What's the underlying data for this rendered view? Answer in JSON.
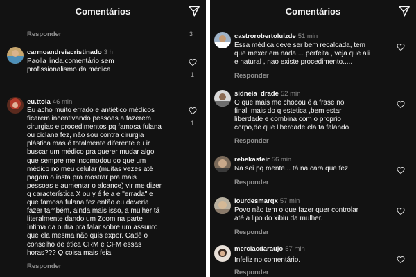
{
  "app": {
    "title": "Comentários",
    "share_icon": "send-icon",
    "heart_icon": "heart-outline-icon",
    "reply_label": "Responder"
  },
  "left": {
    "top_reply_count": "3",
    "comments": [
      {
        "username": "carmoandreiacristinado",
        "time": "3 h",
        "text": [
          "Paolla linda,comentário sem",
          "profissionalismo da médica"
        ],
        "likes": "1"
      },
      {
        "username": "eu.ttoia",
        "time": "46 min",
        "text": [
          "Eu acho muito errado e antiético médicos",
          "ficarem incentivando pessoas a fazerem",
          "cirurgias e procedimentos pq famosa fulana",
          "ou ciclana fez, não sou contra cirurgia",
          "plástica mas é totalmente diferente eu ir",
          "buscar um médico pra querer mudar algo",
          "que sempre me incomodou do que um",
          "médico no meu celular (muitas vezes até",
          "pagam o insta pra mostrar pra mais",
          "pessoas e aumentar o alcance) vir me dizer",
          "q característica X ou y é feia e \"errada\" e",
          "que famosa fulana fez então eu deveria",
          "fazer também, ainda mais isso, a mulher tá",
          "literalmente dando um Zoom na parte",
          "íntima da outra pra falar sobre um assunto",
          "que ela mesma não quis expor. Cadê o",
          "conselho de ética CRM e CFM essas",
          "horas??? Q coisa mais feia"
        ],
        "likes": "1"
      }
    ]
  },
  "right": {
    "comments": [
      {
        "username": "castrorobertoluizde",
        "time": "51 min",
        "text": [
          "Essa médica deve ser bem recalcada,  tem",
          "que mexer em nada.... perfeita , veja que ali",
          "e natural , nao existe procedimento....."
        ]
      },
      {
        "username": "sidneia_drade",
        "time": "52 min",
        "text": [
          "O que mais me chocou é a frase no",
          "final ,mais do q estetica ,bem estar",
          "liberdade e combina com o proprio",
          "corpo,de que liberdade ela ta falando"
        ]
      },
      {
        "username": "rebekasfeir",
        "time": "56 min",
        "text": [
          "Na sei pq mente... tá na cara que fez"
        ]
      },
      {
        "username": "lourdesmarqx",
        "time": "57 min",
        "text": [
          "Povo não  tem o que  fazer quer controlar",
          "até  a lipo do xibiu da mulher."
        ]
      },
      {
        "username": "merciacdaraujo",
        "time": "57 min",
        "text": [
          "Infeliz no comentário."
        ]
      }
    ]
  }
}
